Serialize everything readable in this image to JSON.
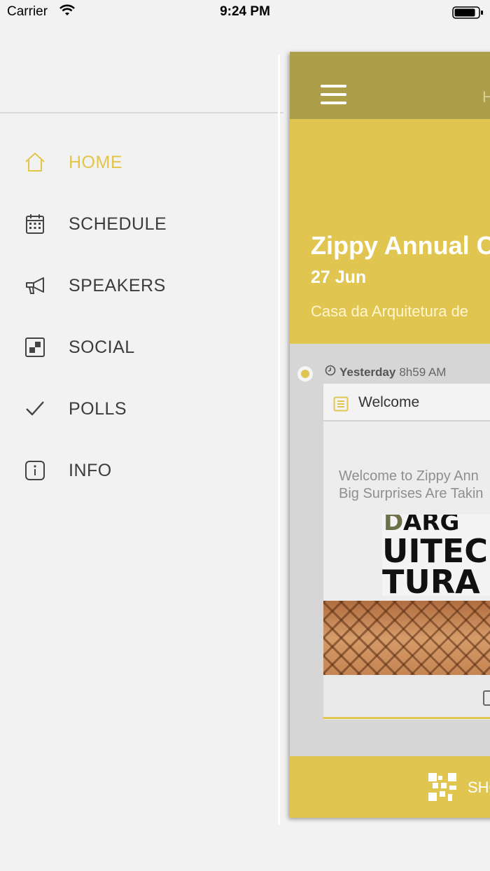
{
  "status_bar": {
    "carrier": "Carrier",
    "time": "9:24 PM"
  },
  "colors": {
    "accent": "#e0c651",
    "active_menu": "#e3c54a",
    "nav_bar": "#ad9f49",
    "background": "#f2f2f2"
  },
  "menu": {
    "items": [
      {
        "label": "HOME",
        "icon": "home-icon",
        "active": true
      },
      {
        "label": "SCHEDULE",
        "icon": "calendar-icon",
        "active": false
      },
      {
        "label": "SPEAKERS",
        "icon": "megaphone-icon",
        "active": false
      },
      {
        "label": "SOCIAL",
        "icon": "social-square-icon",
        "active": false
      },
      {
        "label": "POLLS",
        "icon": "checkmark-icon",
        "active": false
      },
      {
        "label": "INFO",
        "icon": "info-icon",
        "active": false
      }
    ]
  },
  "main": {
    "nav_title": "H",
    "event": {
      "title": "Zippy Annual C",
      "date": "27 Jun",
      "venue": "Casa da Arquitetura de"
    },
    "feed": {
      "post": {
        "day": "Yesterday",
        "time": "8h59 AM",
        "title": "Welcome",
        "body_line1": "Welcome to Zippy Ann",
        "body_line2": "Big Surprises Are Takin",
        "image_text": "D A R S U I T E C T U R A"
      }
    },
    "bottom_label": "SHO"
  }
}
